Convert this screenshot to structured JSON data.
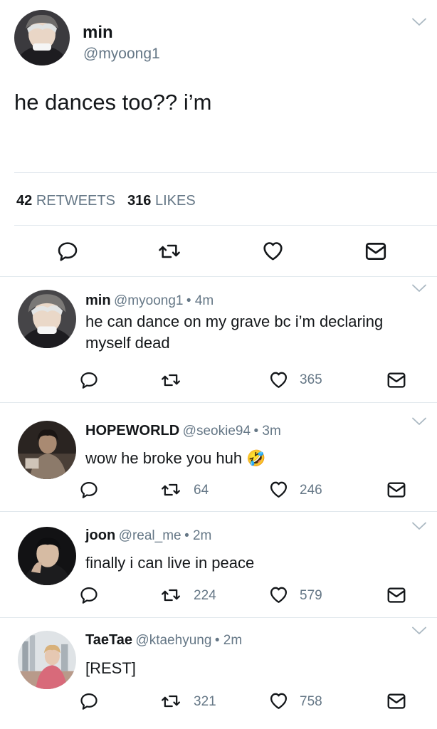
{
  "main_tweet": {
    "name": "min",
    "handle": "@myoong1",
    "text": "he dances too?? i’m",
    "retweets_count": "42",
    "retweets_label": "RETWEETS",
    "likes_count": "316",
    "likes_label": "LIKES"
  },
  "replies": [
    {
      "name": "min",
      "handle": "@myoong1",
      "time": "• 4m",
      "text_line1": "he can dance on my grave bc i’m declaring",
      "text_line2": "myself dead",
      "retweets": "",
      "likes": "365"
    },
    {
      "name": "HOPEWORLD",
      "handle": "@seokie94",
      "time": "• 3m",
      "text_line1": "wow he broke you huh",
      "emoji": "🤣",
      "retweets": "64",
      "likes": "246"
    },
    {
      "name": "joon",
      "handle": "@real_me",
      "time": "• 2m",
      "text_line1": "finally i can live in peace",
      "retweets": "224",
      "likes": "579"
    },
    {
      "name": "TaeTae",
      "handle": "@ktaehyung",
      "time": "• 2m",
      "text_line1": "[REST]",
      "retweets": "321",
      "likes": "758"
    }
  ],
  "colors": {
    "text": "#14171a",
    "secondary": "#657786",
    "divider": "#e1e8ed"
  },
  "icons": [
    "chevron-down-icon",
    "reply-icon",
    "retweet-icon",
    "heart-icon",
    "direct-message-icon"
  ]
}
